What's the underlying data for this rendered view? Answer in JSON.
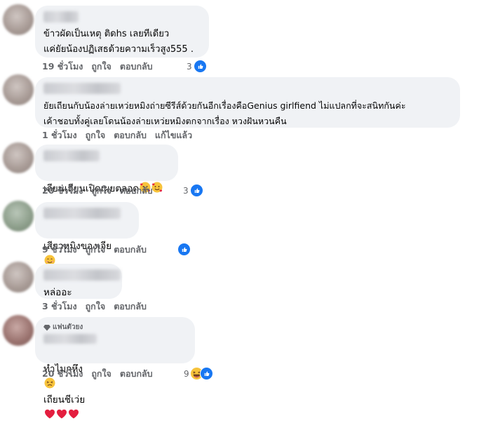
{
  "comments": [
    {
      "text": "ข้าวผัดเป็นเหตุ ติดhs เลยทีเดียว\nแค่ยัยน้องปฏิเสธด้วยความเร็วสูง555 .",
      "time": "19 ชั่วโมง",
      "like": "ถูกใจ",
      "reply": "ตอบกลับ",
      "reaction_count": "3",
      "reactions": [
        "like-icon"
      ]
    },
    {
      "text": "ยัยเถียนกับน้องล่ายเหว่ยหมิงถ่ายซีรีส์ด้วยกันอีกเรื่องคือGenius girlfiend ไม่แปลกที่จะสนิทกันค่ะ\nเค้าชอบทั้งคู่เลยโดนน้องล่ายเหว่ยหมิงตกจากเรื่อง หวงฝันหวนคืน",
      "time": "1 ชั่วโมง",
      "like": "ถูกใจ",
      "reply": "ตอบกลับ",
      "edited": "แก้ไขแล้ว"
    },
    {
      "text": "เถียนเถียนเปิดเผยตลอด",
      "emoji": [
        "smiling-face-with-hearts-icon",
        "smiling-face-with-hearts-icon"
      ],
      "time": "20 ชั่วโมง",
      "like": "ถูกใจ",
      "reply": "ตอบกลับ",
      "reaction_count": "3",
      "reactions": [
        "like-icon"
      ]
    },
    {
      "text": "เสียวหมิงของเจีย",
      "emoji": [
        "smiling-face-icon"
      ],
      "time": "9 ชั่วโมง",
      "like": "ถูกใจ",
      "reply": "ตอบกลับ",
      "reactions": [
        "like-icon"
      ]
    },
    {
      "text": "หล่ออะ",
      "time": "3 ชั่วโมง",
      "like": "ถูกใจ",
      "reply": "ตอบกลับ"
    },
    {
      "badge": "แฟนตัวยง",
      "text": "ทำไมกูหึง",
      "text_after": "เถียนชีเว่ย",
      "emoji_mid": "persevering-face-icon",
      "emoji": [
        "red-heart-icon",
        "red-heart-icon",
        "red-heart-icon"
      ],
      "time": "20 ชั่วโมง",
      "like": "ถูกใจ",
      "reply": "ตอบกลับ",
      "reaction_count": "9",
      "reactions": [
        "haha-icon",
        "like-icon"
      ]
    }
  ],
  "colors": {
    "bubble": "#f0f2f5",
    "meta": "#65676b",
    "like": "#1877f2",
    "heart": "#e41e3f"
  }
}
